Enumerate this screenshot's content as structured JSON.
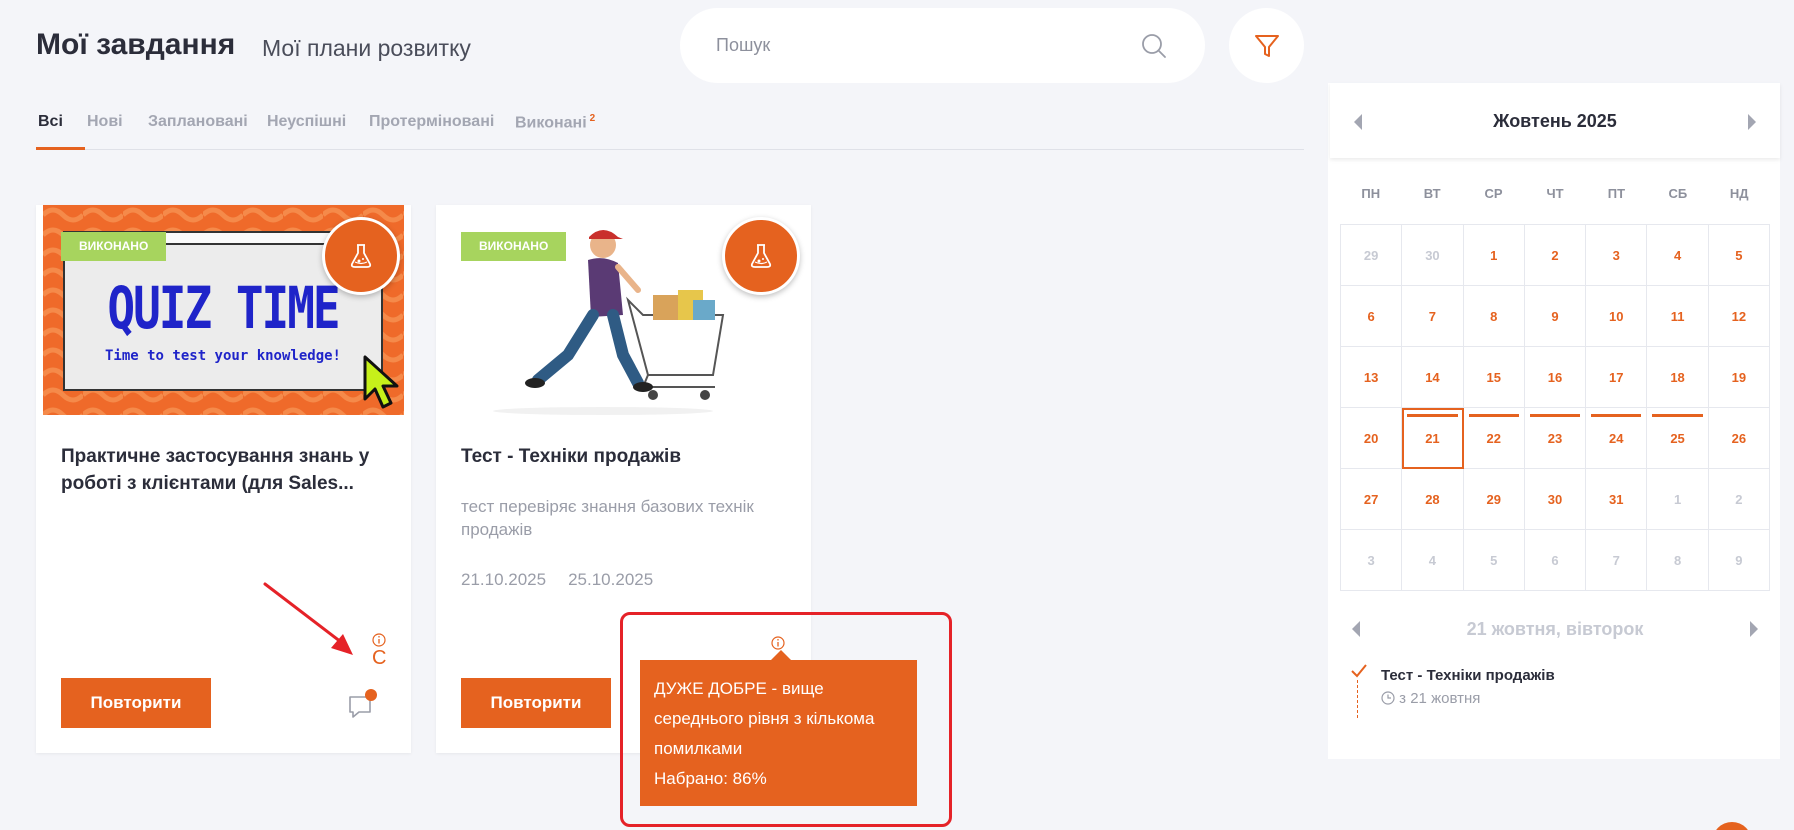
{
  "header": {
    "title": "Мої завдання",
    "subtitle": "Мої плани розвитку"
  },
  "search": {
    "placeholder": "Пошук",
    "value": ""
  },
  "tabs": [
    {
      "label": "Всі",
      "active": true
    },
    {
      "label": "Нові"
    },
    {
      "label": "Заплановані"
    },
    {
      "label": "Неуспішні"
    },
    {
      "label": "Протерміновані"
    },
    {
      "label": "Виконані",
      "count": "2"
    }
  ],
  "cards": [
    {
      "status": "ВИКОНАНО",
      "image_title": "QUIZ TIME",
      "image_subtitle": "Time to test your knowledge!",
      "title": "Практичне застосування знань у роботі з клієнтами (для Sales...",
      "score_letter": "C",
      "button": "Повторити"
    },
    {
      "status": "ВИКОНАНО",
      "title": "Тест - Техніки продажів",
      "description": "тест перевіряє знання базових технік продажів",
      "date_start": "21.10.2025",
      "date_end": "25.10.2025",
      "button": "Повторити"
    }
  ],
  "tooltip": {
    "text": "ДУЖЕ ДОБРЕ - вище середнього рівня з кількома помилками",
    "score": "Набрано: 86%"
  },
  "calendar": {
    "month_label": "Жовтень 2025",
    "weekdays": [
      "ПН",
      "ВТ",
      "СР",
      "ЧТ",
      "ПТ",
      "СБ",
      "НД"
    ],
    "days": [
      {
        "d": "29",
        "muted": true
      },
      {
        "d": "30",
        "muted": true
      },
      {
        "d": "1"
      },
      {
        "d": "2"
      },
      {
        "d": "3"
      },
      {
        "d": "4"
      },
      {
        "d": "5"
      },
      {
        "d": "6"
      },
      {
        "d": "7"
      },
      {
        "d": "8"
      },
      {
        "d": "9"
      },
      {
        "d": "10"
      },
      {
        "d": "11"
      },
      {
        "d": "12"
      },
      {
        "d": "13"
      },
      {
        "d": "14"
      },
      {
        "d": "15"
      },
      {
        "d": "16"
      },
      {
        "d": "17"
      },
      {
        "d": "18"
      },
      {
        "d": "19"
      },
      {
        "d": "20"
      },
      {
        "d": "21",
        "today": true,
        "event": true
      },
      {
        "d": "22",
        "event": true
      },
      {
        "d": "23",
        "event": true
      },
      {
        "d": "24",
        "event": true
      },
      {
        "d": "25",
        "event": true
      },
      {
        "d": "26"
      },
      {
        "d": "27"
      },
      {
        "d": "28"
      },
      {
        "d": "29"
      },
      {
        "d": "30"
      },
      {
        "d": "31"
      },
      {
        "d": "1",
        "muted": true
      },
      {
        "d": "2",
        "muted": true
      },
      {
        "d": "3",
        "muted": true
      },
      {
        "d": "4",
        "muted": true
      },
      {
        "d": "5",
        "muted": true
      },
      {
        "d": "6",
        "muted": true
      },
      {
        "d": "7",
        "muted": true
      },
      {
        "d": "8",
        "muted": true
      },
      {
        "d": "9",
        "muted": true
      }
    ],
    "selected_day_label": "21 жовтня, вівторок",
    "events": [
      {
        "title": "Тест - Техніки продажів",
        "time": "з 21 жовтня"
      }
    ]
  },
  "colors": {
    "accent": "#e5621f",
    "done_badge": "#a7d45e",
    "highlight_frame": "#e52228"
  }
}
